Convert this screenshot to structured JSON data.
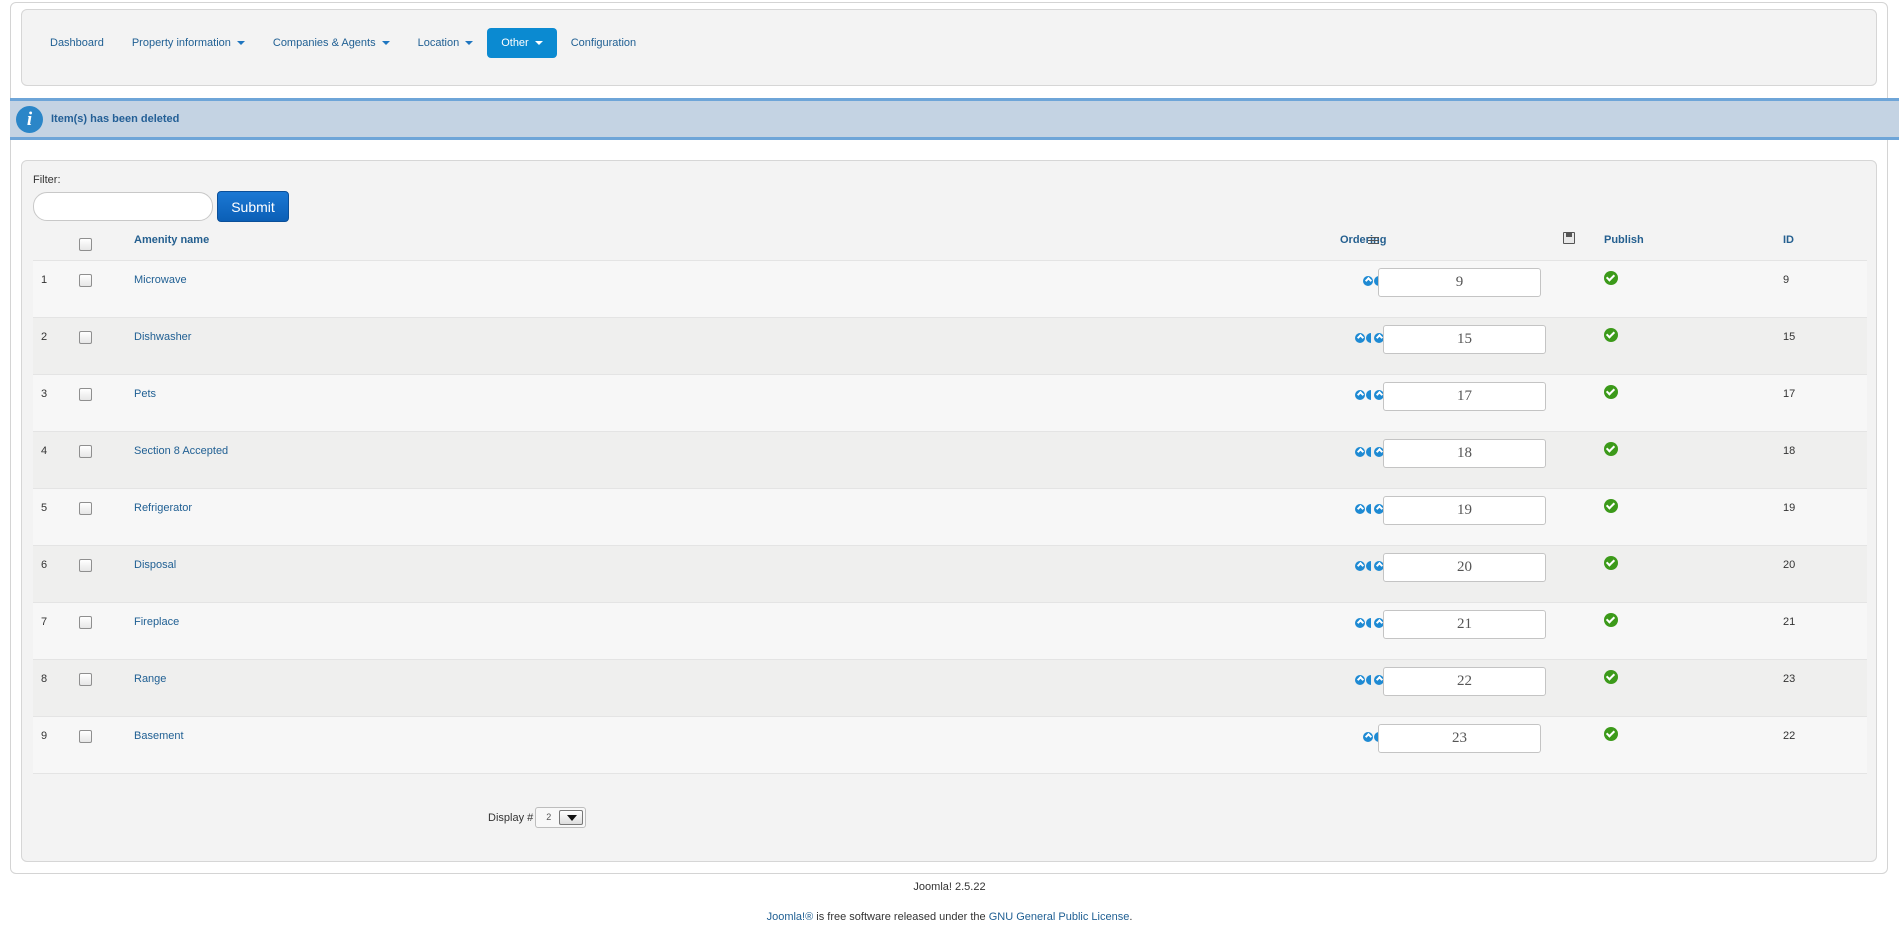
{
  "nav": {
    "items": [
      {
        "label": "Dashboard",
        "dropdown": false,
        "active": false
      },
      {
        "label": "Property information",
        "dropdown": true,
        "active": false
      },
      {
        "label": "Companies & Agents",
        "dropdown": true,
        "active": false
      },
      {
        "label": "Location",
        "dropdown": true,
        "active": false
      },
      {
        "label": "Other",
        "dropdown": true,
        "active": true
      },
      {
        "label": "Configuration",
        "dropdown": false,
        "active": false
      }
    ]
  },
  "message": {
    "icon": "info-icon",
    "text": "Item(s) has been deleted"
  },
  "filter": {
    "label": "Filter:",
    "value": "",
    "submit_label": "Submit"
  },
  "table": {
    "headers": {
      "name": "Amenity name",
      "ordering": "Ordering",
      "publish": "Publish",
      "id": "ID"
    },
    "rows": [
      {
        "num": "1",
        "name": "Microwave",
        "order": "9",
        "id": "9",
        "published": true,
        "arrows": 1
      },
      {
        "num": "2",
        "name": "Dishwasher",
        "order": "15",
        "id": "15",
        "published": true,
        "arrows": 2
      },
      {
        "num": "3",
        "name": "Pets",
        "order": "17",
        "id": "17",
        "published": true,
        "arrows": 2
      },
      {
        "num": "4",
        "name": "Section 8 Accepted",
        "order": "18",
        "id": "18",
        "published": true,
        "arrows": 2
      },
      {
        "num": "5",
        "name": "Refrigerator",
        "order": "19",
        "id": "19",
        "published": true,
        "arrows": 2
      },
      {
        "num": "6",
        "name": "Disposal",
        "order": "20",
        "id": "20",
        "published": true,
        "arrows": 2
      },
      {
        "num": "7",
        "name": "Fireplace",
        "order": "21",
        "id": "21",
        "published": true,
        "arrows": 2
      },
      {
        "num": "8",
        "name": "Range",
        "order": "22",
        "id": "23",
        "published": true,
        "arrows": 2
      },
      {
        "num": "9",
        "name": "Basement",
        "order": "23",
        "id": "22",
        "published": true,
        "arrows": 1
      }
    ]
  },
  "pagination": {
    "display_label": "Display #",
    "display_value": "2"
  },
  "footer": {
    "version": "Joomla! 2.5.22",
    "joomla_link": "Joomla!®",
    "license_mid": " is free software released under the ",
    "license_link": "GNU General Public License",
    "license_end": "."
  },
  "colors": {
    "accent": "#0b8ad1",
    "link": "#1f5f93",
    "message_bg": "#c4d3e3",
    "publish_green": "#3c9a1a"
  }
}
